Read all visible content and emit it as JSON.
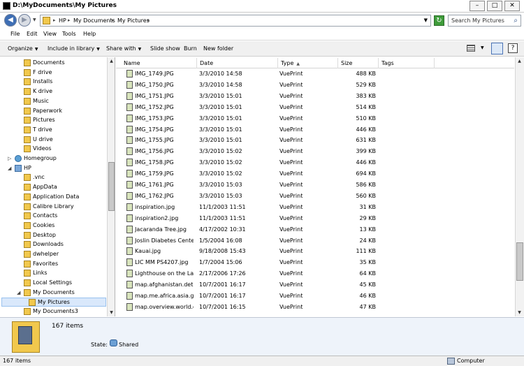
{
  "window": {
    "title": "D:\\MyDocuments\\My Pictures",
    "minimize_glyph": "–",
    "maximize_glyph": "□",
    "close_glyph": "✕"
  },
  "address": {
    "crumbs": [
      "HP",
      "My Documents",
      "My Pictures"
    ],
    "separator": "▸",
    "search_placeholder": "Search My Pictures"
  },
  "menu": {
    "file": "File",
    "edit": "Edit",
    "view": "View",
    "tools": "Tools",
    "help": "Help"
  },
  "commands": {
    "organize": "Organize",
    "include_in_library": "Include in library",
    "share_with": "Share with",
    "slide_show": "Slide show",
    "burn": "Burn",
    "new_folder": "New folder",
    "caret": "▼"
  },
  "nav": [
    {
      "label": "Documents",
      "icon": "folder"
    },
    {
      "label": "F drive",
      "icon": "folder"
    },
    {
      "label": "Installs",
      "icon": "folder"
    },
    {
      "label": "K drive",
      "icon": "folder"
    },
    {
      "label": "Music",
      "icon": "folder"
    },
    {
      "label": "Paperwork",
      "icon": "folder"
    },
    {
      "label": "Pictures",
      "icon": "folder"
    },
    {
      "label": "T drive",
      "icon": "folder"
    },
    {
      "label": "U drive",
      "icon": "folder"
    },
    {
      "label": "Videos",
      "icon": "folder"
    },
    {
      "label": "Homegroup",
      "icon": "homegroup"
    },
    {
      "label": "HP",
      "icon": "user"
    },
    {
      "label": ".vnc",
      "icon": "folder"
    },
    {
      "label": "AppData",
      "icon": "folder"
    },
    {
      "label": "Application Data",
      "icon": "folder"
    },
    {
      "label": "Calibre Library",
      "icon": "folder"
    },
    {
      "label": "Contacts",
      "icon": "folder"
    },
    {
      "label": "Cookies",
      "icon": "folder"
    },
    {
      "label": "Desktop",
      "icon": "folder"
    },
    {
      "label": "Downloads",
      "icon": "folder"
    },
    {
      "label": "dwhelper",
      "icon": "folder"
    },
    {
      "label": "Favorites",
      "icon": "folder"
    },
    {
      "label": "Links",
      "icon": "folder"
    },
    {
      "label": "Local Settings",
      "icon": "folder"
    },
    {
      "label": "My Documents",
      "icon": "folder"
    },
    {
      "label": "My Pictures",
      "icon": "folder"
    },
    {
      "label": "My Documents3",
      "icon": "folder"
    }
  ],
  "columns": {
    "name": "Name",
    "date": "Date",
    "type": "Type",
    "size": "Size",
    "tags": "Tags",
    "sort_indicator": "▲"
  },
  "files": [
    {
      "name": "IMG_1749.JPG",
      "date": "3/3/2010 14:58",
      "type": "VuePrint",
      "size": "488 KB"
    },
    {
      "name": "IMG_1750.JPG",
      "date": "3/3/2010 14:58",
      "type": "VuePrint",
      "size": "529 KB"
    },
    {
      "name": "IMG_1751.JPG",
      "date": "3/3/2010 15:01",
      "type": "VuePrint",
      "size": "383 KB"
    },
    {
      "name": "IMG_1752.JPG",
      "date": "3/3/2010 15:01",
      "type": "VuePrint",
      "size": "514 KB"
    },
    {
      "name": "IMG_1753.JPG",
      "date": "3/3/2010 15:01",
      "type": "VuePrint",
      "size": "510 KB"
    },
    {
      "name": "IMG_1754.JPG",
      "date": "3/3/2010 15:01",
      "type": "VuePrint",
      "size": "446 KB"
    },
    {
      "name": "IMG_1755.JPG",
      "date": "3/3/2010 15:01",
      "type": "VuePrint",
      "size": "631 KB"
    },
    {
      "name": "IMG_1756.JPG",
      "date": "3/3/2010 15:02",
      "type": "VuePrint",
      "size": "399 KB"
    },
    {
      "name": "IMG_1758.JPG",
      "date": "3/3/2010 15:02",
      "type": "VuePrint",
      "size": "446 KB"
    },
    {
      "name": "IMG_1759.JPG",
      "date": "3/3/2010 15:02",
      "type": "VuePrint",
      "size": "694 KB"
    },
    {
      "name": "IMG_1761.JPG",
      "date": "3/3/2010 15:03",
      "type": "VuePrint",
      "size": "586 KB"
    },
    {
      "name": "IMG_1762.JPG",
      "date": "3/3/2010 15:03",
      "type": "VuePrint",
      "size": "560 KB"
    },
    {
      "name": "inspiration.jpg",
      "date": "11/1/2003 11:51",
      "type": "VuePrint",
      "size": "31 KB"
    },
    {
      "name": "inspiration2.jpg",
      "date": "11/1/2003 11:51",
      "type": "VuePrint",
      "size": "29 KB"
    },
    {
      "name": "Jacaranda Tree.jpg",
      "date": "4/17/2002 10:31",
      "type": "VuePrint",
      "size": "13 KB"
    },
    {
      "name": "Joslin Diabetes Cente...",
      "date": "1/5/2004 16:08",
      "type": "VuePrint",
      "size": "24 KB"
    },
    {
      "name": "Kauai.jpg",
      "date": "9/18/2008 15:43",
      "type": "VuePrint",
      "size": "111 KB"
    },
    {
      "name": "LIC MM PS4207.jpg",
      "date": "1/7/2004 15:06",
      "type": "VuePrint",
      "size": "35 KB"
    },
    {
      "name": "Lighthouse on the La...",
      "date": "2/17/2006 17:26",
      "type": "VuePrint",
      "size": "64 KB"
    },
    {
      "name": "map.afghanistan.det...",
      "date": "10/7/2001 16:17",
      "type": "VuePrint",
      "size": "45 KB"
    },
    {
      "name": "map.me.africa.asia.gif",
      "date": "10/7/2001 16:17",
      "type": "VuePrint",
      "size": "46 KB"
    },
    {
      "name": "map.overview.world.gif",
      "date": "10/7/2001 16:15",
      "type": "VuePrint",
      "size": "47 KB"
    }
  ],
  "details": {
    "count": "167 items",
    "state_label": "State:",
    "state_value": "Shared"
  },
  "status": {
    "left": "167 items",
    "right": "Computer"
  }
}
